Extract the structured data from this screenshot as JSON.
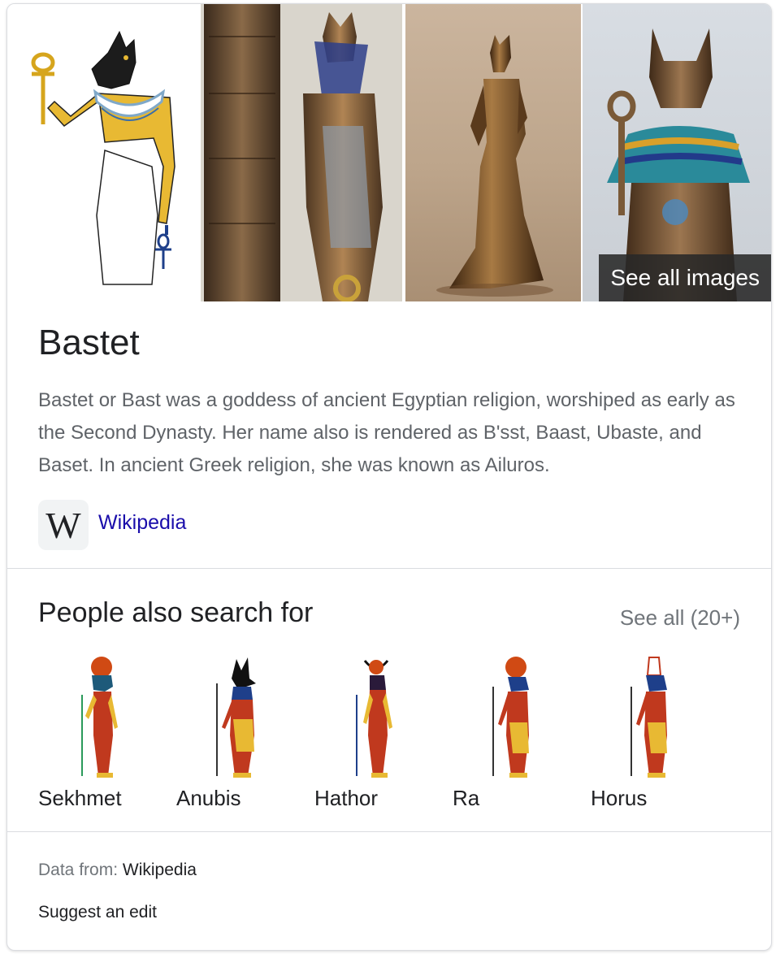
{
  "images": {
    "tiles": [
      {
        "icon": "bastet-drawing-image"
      },
      {
        "icon": "bastet-statue-column-image"
      },
      {
        "icon": "bastet-bronze-figure-image"
      },
      {
        "icon": "bastet-statue-ankh-image"
      }
    ],
    "see_all_label": "See all images"
  },
  "entity": {
    "title": "Bastet",
    "description": "Bastet or Bast was a goddess of ancient Egyptian religion, worshiped as early as the Second Dynasty. Her name also is rendered as B'sst, Baast, Ubaste, and Baset. In ancient Greek religion, she was known as Ailuros.",
    "source_logo": "W",
    "source_label": "Wikipedia"
  },
  "people_also_search": {
    "title": "People also search for",
    "see_all_label": "See all (20+)",
    "items": [
      {
        "name": "Sekhmet",
        "head_color": "#d04a14",
        "icon": "sekhmet-figure-icon"
      },
      {
        "name": "Anubis",
        "head_color": "#111111",
        "icon": "anubis-figure-icon"
      },
      {
        "name": "Hathor",
        "head_color": "#d04a14",
        "icon": "hathor-figure-icon"
      },
      {
        "name": "Ra",
        "head_color": "#d04a14",
        "icon": "ra-figure-icon"
      },
      {
        "name": "Horus",
        "head_color": "#ffffff",
        "icon": "horus-figure-icon"
      }
    ]
  },
  "footer": {
    "data_from_label": "Data from: ",
    "data_from_source": "Wikipedia",
    "suggest_edit_label": "Suggest an edit"
  },
  "colors": {
    "link": "#1a0dab",
    "muted": "#70757a",
    "body_text": "#5f6368",
    "ochre": "#e8b933",
    "egypt_red": "#c0391e",
    "egypt_blue": "#1e3f8a"
  }
}
